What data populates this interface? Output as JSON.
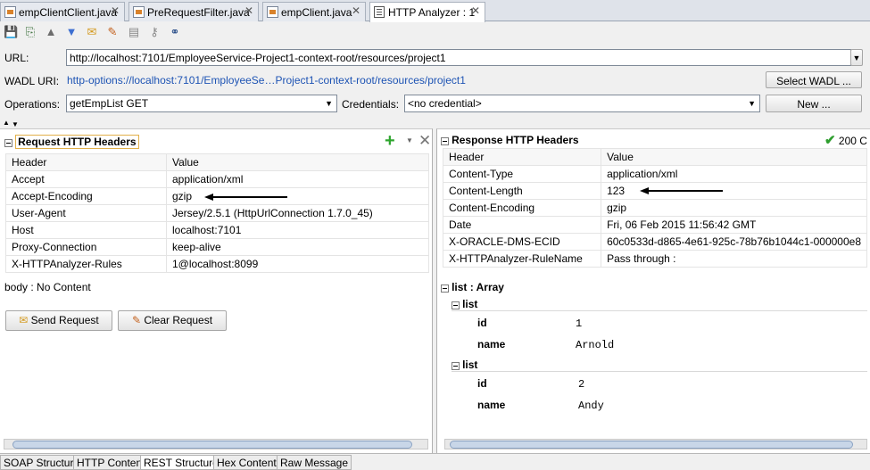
{
  "tabs": [
    {
      "label": "empClientClient.java"
    },
    {
      "label": "PreRequestFilter.java"
    },
    {
      "label": "empClient.java"
    },
    {
      "label": "HTTP Analyzer : 1"
    }
  ],
  "form": {
    "url_label": "URL:",
    "url_value": "http://localhost:7101/EmployeeService-Project1-context-root/resources/project1",
    "wadl_label": "WADL URI:",
    "wadl_value": "http-options://localhost:7101/EmployeeSe…Project1-context-root/resources/project1",
    "select_wadl_button": "Select WADL ...",
    "operations_label": "Operations:",
    "operations_value": "getEmpList GET",
    "credentials_label": "Credentials:",
    "credentials_value": "<no credential>",
    "new_button": "New ..."
  },
  "request": {
    "title": "Request HTTP Headers",
    "col_header": "Header",
    "col_value": "Value",
    "rows": [
      {
        "header": "Accept",
        "value": "application/xml"
      },
      {
        "header": "Accept-Encoding",
        "value": "gzip"
      },
      {
        "header": "User-Agent",
        "value": "Jersey/2.5.1 (HttpUrlConnection 1.7.0_45)"
      },
      {
        "header": "Host",
        "value": "localhost:7101"
      },
      {
        "header": "Proxy-Connection",
        "value": "keep-alive"
      },
      {
        "header": "X-HTTPAnalyzer-Rules",
        "value": "1@localhost:8099"
      }
    ],
    "body_text": "body : No Content",
    "send_button": "Send Request",
    "clear_button": "Clear Request"
  },
  "response": {
    "title": "Response HTTP Headers",
    "status": "200 C",
    "col_header": "Header",
    "col_value": "Value",
    "rows": [
      {
        "header": "Content-Type",
        "value": "application/xml"
      },
      {
        "header": "Content-Length",
        "value": "123"
      },
      {
        "header": "Content-Encoding",
        "value": "gzip"
      },
      {
        "header": "Date",
        "value": "Fri, 06 Feb 2015 11:56:42 GMT"
      },
      {
        "header": "X-ORACLE-DMS-ECID",
        "value": "60c0533d-d865-4e61-925c-78b76b1044c1-000000e8"
      },
      {
        "header": "X-HTTPAnalyzer-RuleName",
        "value": "Pass through :"
      }
    ],
    "array_title": "list : Array",
    "lists": [
      {
        "title": "list",
        "id_label": "id",
        "id_value": "1",
        "name_label": "name",
        "name_value": "Arnold"
      },
      {
        "title": "list",
        "id_label": "id",
        "id_value": "2",
        "name_label": "name",
        "name_value": "Andy"
      }
    ]
  },
  "bottom_tabs": [
    {
      "label": "SOAP Structure"
    },
    {
      "label": "HTTP Content"
    },
    {
      "label": "REST Structure"
    },
    {
      "label": "Hex Content"
    },
    {
      "label": "Raw Message"
    }
  ],
  "colors": {
    "link": "#1e54b4",
    "status_ok": "#2e9e2e",
    "add": "#2fa52f"
  }
}
